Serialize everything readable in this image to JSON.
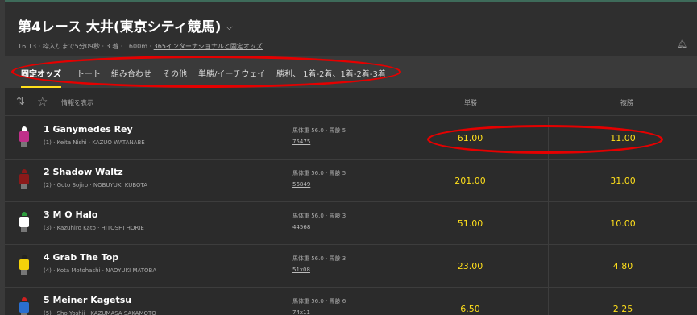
{
  "header": {
    "title": "第4レース 大井(東京シティ競馬)",
    "subline": "16:13 · 枠入りまで5分09秒 · 3 着 · 1600m ·",
    "subline_link": "365インターナショナルと固定オッズ"
  },
  "tabs": [
    {
      "label": "固定オッズ",
      "active": true
    },
    {
      "label": "トート"
    },
    {
      "label": "組み合わせ"
    },
    {
      "label": "その他"
    },
    {
      "label": "単勝/イーチウェイ"
    },
    {
      "label": "勝利、 1着-2着、1着-2着-3着"
    }
  ],
  "columns": {
    "info_label": "情報を表示",
    "win": "単勝",
    "place": "複勝"
  },
  "runners": [
    {
      "name": "1  Ganymedes Rey",
      "jockey": "(1) · Keita Nishi · KAZUO WATANABE",
      "meta1": "馬体重 56.0 · 馬齢 5",
      "meta2": "75475",
      "win": "61.00",
      "place": "11.00",
      "silk_cap": "#ffffff",
      "silk_body": "#c0308a"
    },
    {
      "name": "2  Shadow Waltz",
      "jockey": "(2) · Goto Sojiro · NOBUYUKI KUBOTA",
      "meta1": "馬体重 56.0 · 馬齢 5",
      "meta2": "56849",
      "win": "201.00",
      "place": "31.00",
      "silk_cap": "#8b1a1a",
      "silk_body": "#8b1a1a"
    },
    {
      "name": "3  M O Halo",
      "jockey": "(3) · Kazuhiro Kato · HITOSHI HORIE",
      "meta1": "馬体重 56.0 · 馬齢 3",
      "meta2": "44568",
      "win": "51.00",
      "place": "10.00",
      "silk_cap": "#2e9e3e",
      "silk_body": "#ffffff"
    },
    {
      "name": "4  Grab The Top",
      "jockey": "(4) · Kota Motohashi · NAOYUKI MATOBA",
      "meta1": "馬体重 56.0 · 馬齢 3",
      "meta2": "51x08",
      "win": "23.00",
      "place": "4.80",
      "silk_cap": "#222222",
      "silk_body": "#f4d20a"
    },
    {
      "name": "5  Meiner Kagetsu",
      "jockey": "(5) · Sho Yoshii · KAZUMASA SAKAMOTO",
      "meta1": "馬体重 56.0 · 馬齢 6",
      "meta2": "74x11",
      "win": "6.50",
      "place": "2.25",
      "silk_cap": "#d02020",
      "silk_body": "#2a6fd0"
    }
  ],
  "icons": {
    "chevron": "chevron-down-icon",
    "bell": "bell-icon",
    "sort": "sort-icon",
    "star": "star-icon"
  },
  "colors": {
    "odds": "#ffdf1b",
    "highlight_oval": "#e50000"
  }
}
